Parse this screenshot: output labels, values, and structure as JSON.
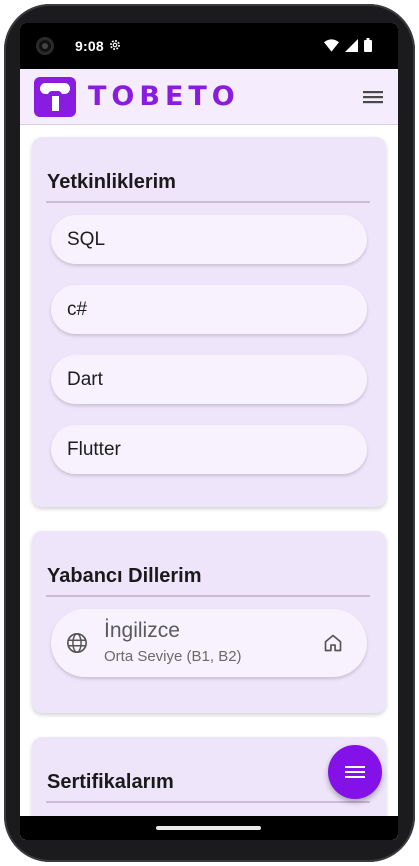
{
  "status_bar": {
    "time": "9:08",
    "icons": [
      "settings-gear-icon",
      "wifi-icon",
      "cellular-signal-icon",
      "battery-icon"
    ]
  },
  "app_bar": {
    "brand": "TOBETO",
    "brand_color": "#8a1be0",
    "menu_icon": "hamburger-menu-icon"
  },
  "skills": {
    "title": "Yetkinliklerim",
    "items": [
      {
        "label": "SQL"
      },
      {
        "label": "c#"
      },
      {
        "label": "Dart"
      },
      {
        "label": "Flutter"
      }
    ]
  },
  "languages": {
    "title": "Yabancı Dillerim",
    "items": [
      {
        "name": "İngilizce",
        "level": "Orta Seviye (B1, B2)",
        "icon": "globe-icon",
        "action_icon": "home-icon"
      }
    ]
  },
  "certificates": {
    "title": "Sertifikalarım"
  },
  "fab": {
    "icon": "menu-lines-icon",
    "color": "#8412e8"
  },
  "colors": {
    "card_bg": "#efe5fb",
    "app_bar_bg": "#f5ecfd",
    "accent": "#8a1be0"
  }
}
